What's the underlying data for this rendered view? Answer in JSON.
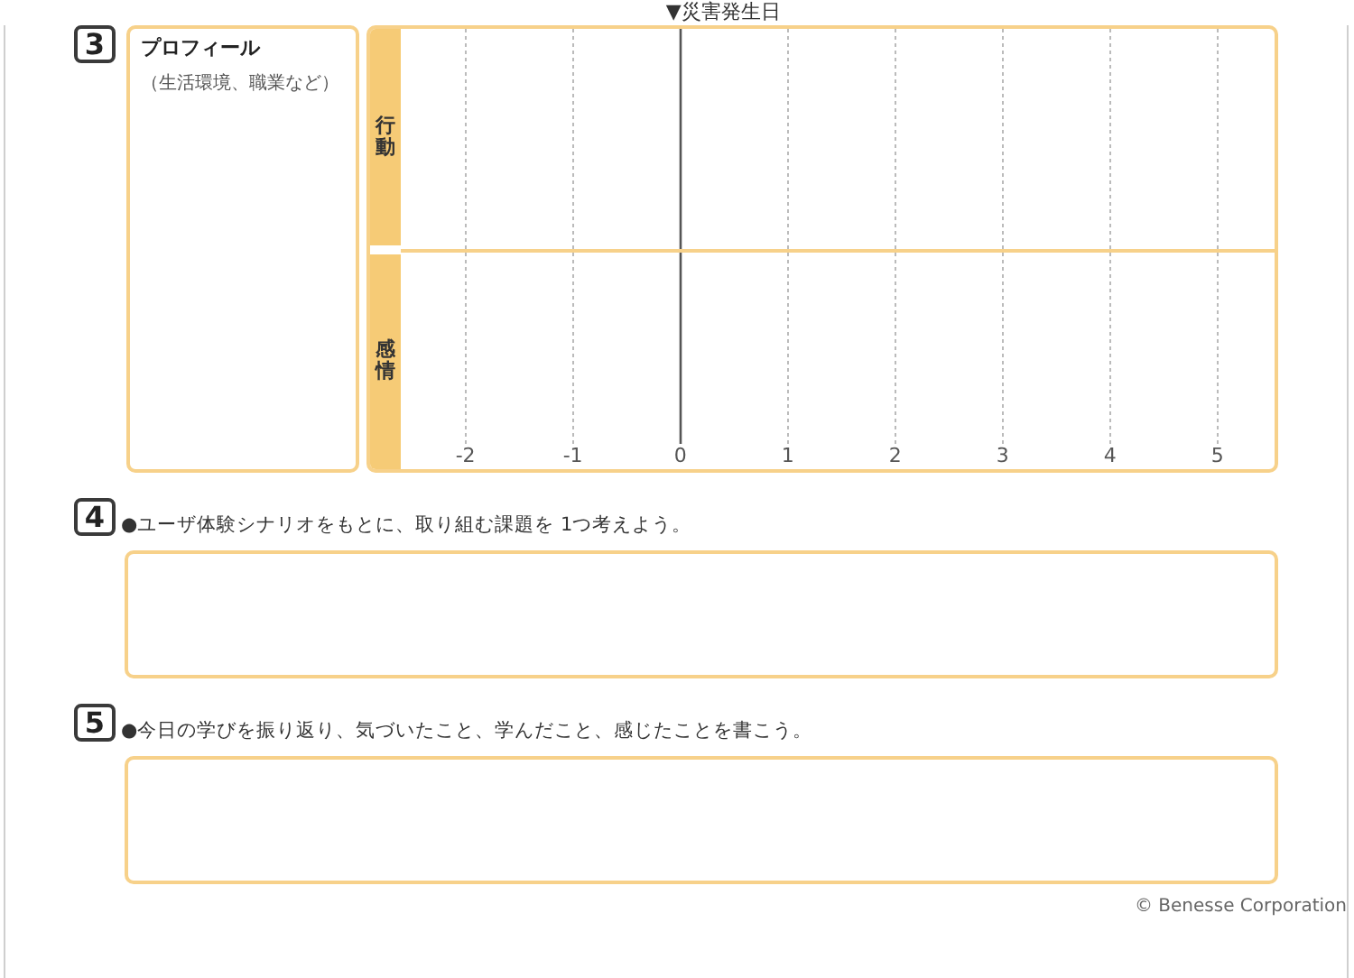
{
  "section_3": {
    "number": "3",
    "profile": {
      "title": "プロフィール",
      "note": "（生活環境、職業など）"
    },
    "timeline": {
      "marker": "▼災害発生日",
      "rows": [
        {
          "label": "行動"
        },
        {
          "label": "感情"
        }
      ],
      "x_ticks": [
        {
          "label": "-2",
          "kind": "grid"
        },
        {
          "label": "-1",
          "kind": "grid"
        },
        {
          "label": "0",
          "kind": "origin"
        },
        {
          "label": "1",
          "kind": "grid"
        },
        {
          "label": "2",
          "kind": "grid"
        },
        {
          "label": "3",
          "kind": "grid"
        },
        {
          "label": "4",
          "kind": "grid"
        },
        {
          "label": "5",
          "kind": "grid"
        }
      ]
    }
  },
  "section_4": {
    "number": "4",
    "prompt": "●ユーザ体験シナリオをもとに、取り組む課題を 1つ考えよう。"
  },
  "section_5": {
    "number": "5",
    "prompt": "●今日の学びを振り返り、気づいたこと、学んだこと、感じたことを書こう。"
  },
  "copyright": "© Benesse Corporation"
}
